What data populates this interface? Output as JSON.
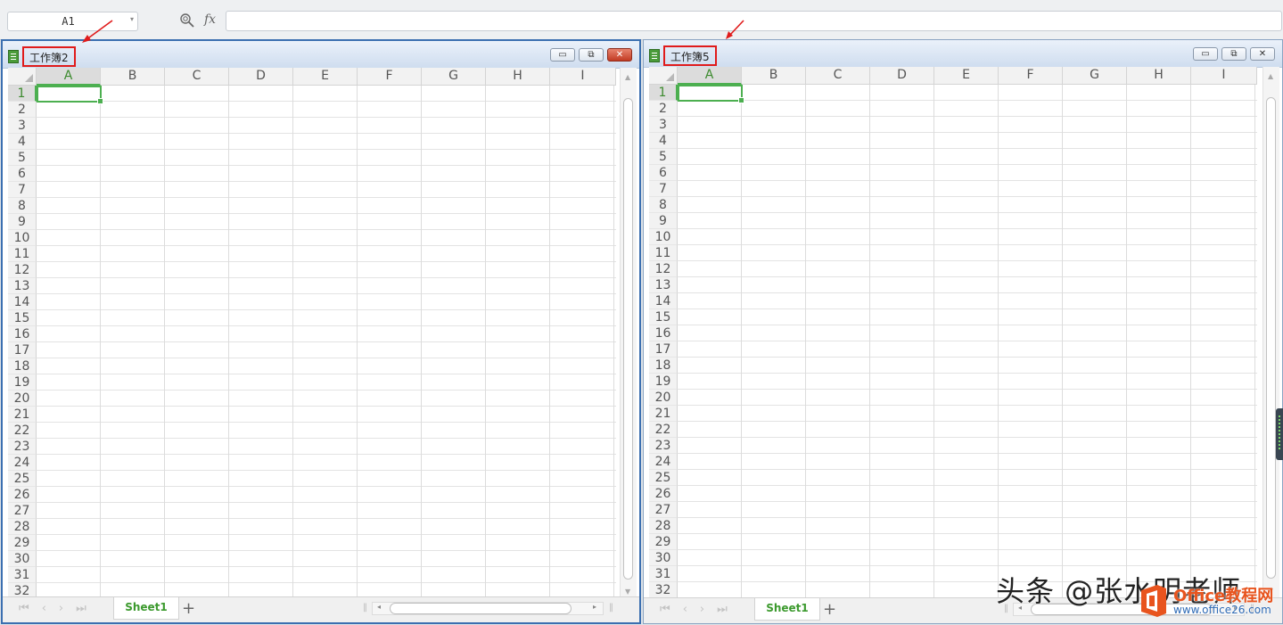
{
  "formula_bar": {
    "name_box": "A1",
    "fx_label": "fx",
    "formula_value": "",
    "icons": [
      "zoom-icon",
      "dropdown-chevron-icon"
    ]
  },
  "windows": [
    {
      "title": "工作簿2",
      "active": true,
      "columns": [
        "A",
        "B",
        "C",
        "D",
        "E",
        "F",
        "G",
        "H",
        "I"
      ],
      "rows": [
        "1",
        "2",
        "3",
        "4",
        "5",
        "6",
        "7",
        "8",
        "9",
        "10",
        "11",
        "12",
        "13",
        "14",
        "15",
        "16",
        "17",
        "18",
        "19",
        "20",
        "21",
        "22",
        "23",
        "24",
        "25",
        "26",
        "27",
        "28",
        "29",
        "30",
        "31",
        "32"
      ],
      "selected_cell": "A1",
      "sheet_tab": "Sheet1",
      "add_sheet": "+",
      "title_highlight_color": "#e01b1b",
      "buttons": [
        "minimize-icon",
        "restore-icon",
        "close-icon"
      ]
    },
    {
      "title": "工作簿5",
      "active": false,
      "columns": [
        "A",
        "B",
        "C",
        "D",
        "E",
        "F",
        "G",
        "H",
        "I"
      ],
      "rows": [
        "1",
        "2",
        "3",
        "4",
        "5",
        "6",
        "7",
        "8",
        "9",
        "10",
        "11",
        "12",
        "13",
        "14",
        "15",
        "16",
        "17",
        "18",
        "19",
        "20",
        "21",
        "22",
        "23",
        "24",
        "25",
        "26",
        "27",
        "28",
        "29",
        "30",
        "31",
        "32"
      ],
      "selected_cell": "A1",
      "sheet_tab": "Sheet1",
      "add_sheet": "+",
      "title_highlight_color": "#e01b1b",
      "buttons": [
        "minimize-icon",
        "restore-icon",
        "close-icon"
      ]
    }
  ],
  "watermark": {
    "text": "头条 @张水明老师",
    "site": "Office教程网",
    "url": "www.office26.com"
  },
  "colors": {
    "accent_green": "#4caf50",
    "annotation_red": "#e01b1b",
    "active_border": "#3b6fb0"
  }
}
